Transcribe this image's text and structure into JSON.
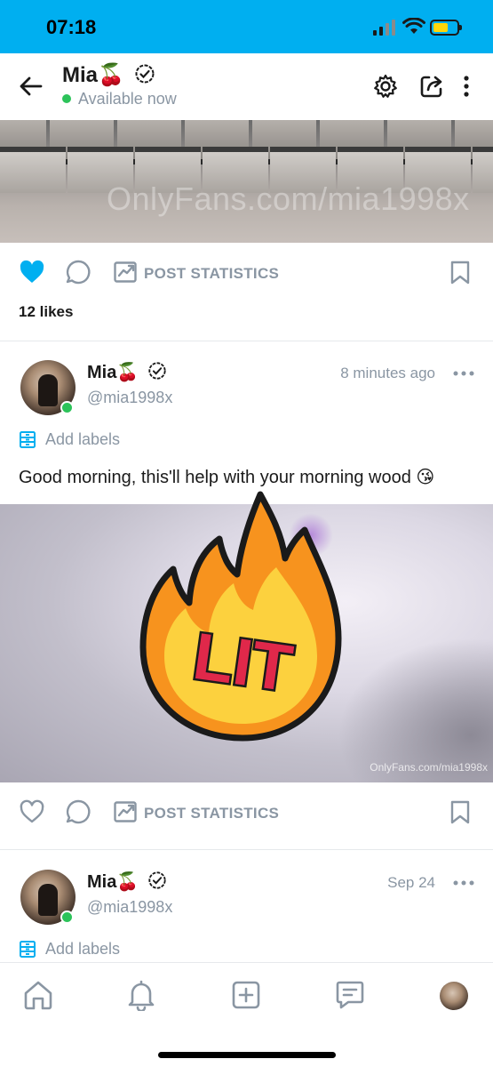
{
  "status_bar": {
    "time": "07:18"
  },
  "header": {
    "name": "Mia🍒",
    "status": "Available now",
    "icons": [
      "back-arrow-icon",
      "gear-icon",
      "share-icon",
      "more-vertical-icon"
    ]
  },
  "top_post": {
    "watermark": "OnlyFans.com/mia1998x",
    "stats_label": "POST STATISTICS",
    "likes": "12 likes"
  },
  "post1": {
    "name": "Mia🍒",
    "handle": "@mia1998x",
    "time": "8 minutes ago",
    "labels": "Add labels",
    "text": "Good morning, this'll help with your morning wood 😘",
    "sticker_text": "LIT",
    "watermark": "OnlyFans.com/mia1998x",
    "stats_label": "POST STATISTICS"
  },
  "post2": {
    "name": "Mia🍒",
    "handle": "@mia1998x",
    "time": "Sep 24",
    "labels": "Add labels"
  },
  "bottom_nav": {
    "items": [
      "home-icon",
      "bell-icon",
      "add-post-icon",
      "messages-icon",
      "profile-avatar"
    ]
  },
  "colors": {
    "brand": "#00aff0",
    "muted": "#8a96a3",
    "online": "#2cc35a",
    "like": "#00aff0"
  }
}
